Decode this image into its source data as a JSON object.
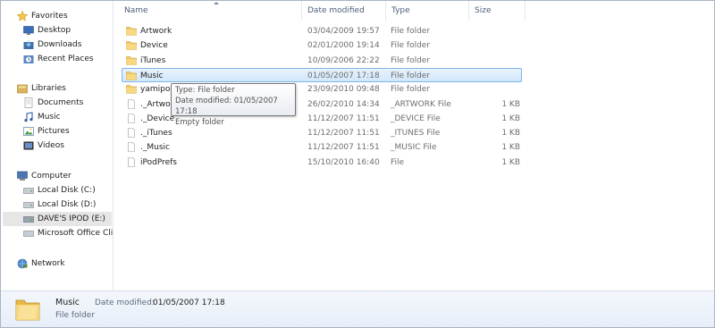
{
  "nav": {
    "favorites": {
      "label": "Favorites",
      "items": [
        "Desktop",
        "Downloads",
        "Recent Places"
      ]
    },
    "libraries": {
      "label": "Libraries",
      "items": [
        "Documents",
        "Music",
        "Pictures",
        "Videos"
      ]
    },
    "computer": {
      "label": "Computer",
      "items": [
        "Local Disk (C:)",
        "Local Disk (D:)",
        "DAVE'S IPOD (E:)",
        "Microsoft Office Clic"
      ]
    },
    "network": {
      "label": "Network"
    }
  },
  "columns": {
    "name": "Name",
    "date": "Date modified",
    "type": "Type",
    "size": "Size"
  },
  "files": [
    {
      "name": "Artwork",
      "date": "03/04/2009 19:57",
      "type": "File folder",
      "size": "",
      "icon": "folder"
    },
    {
      "name": "Device",
      "date": "02/01/2000 19:14",
      "type": "File folder",
      "size": "",
      "icon": "folder"
    },
    {
      "name": "iTunes",
      "date": "10/09/2006 22:22",
      "type": "File folder",
      "size": "",
      "icon": "folder"
    },
    {
      "name": "Music",
      "date": "01/05/2007 17:18",
      "type": "File folder",
      "size": "",
      "icon": "folder"
    },
    {
      "name": "yamipod",
      "date": "23/09/2010 09:48",
      "type": "File folder",
      "size": "",
      "icon": "folder"
    },
    {
      "name": "._Artwork",
      "date": "26/02/2010 14:34",
      "type": "_ARTWORK File",
      "size": "1 KB",
      "icon": "file"
    },
    {
      "name": "._Device",
      "date": "11/12/2007 11:51",
      "type": "_DEVICE File",
      "size": "1 KB",
      "icon": "file"
    },
    {
      "name": "._iTunes",
      "date": "11/12/2007 11:51",
      "type": "_ITUNES File",
      "size": "1 KB",
      "icon": "file"
    },
    {
      "name": "._Music",
      "date": "11/12/2007 11:51",
      "type": "_MUSIC File",
      "size": "1 KB",
      "icon": "file"
    },
    {
      "name": "iPodPrefs",
      "date": "15/10/2010 16:40",
      "type": "File",
      "size": "1 KB",
      "icon": "file"
    }
  ],
  "tooltip": {
    "line1": "Type: File folder",
    "line2": "Date modified: 01/05/2007 17:18",
    "line3": "Empty folder"
  },
  "details": {
    "name": "Music",
    "kind": "File folder",
    "date_label": "Date modified:",
    "date_value": "01/05/2007 17:18"
  },
  "colors": {
    "selection_border": "#7eb4ea",
    "folder": "#f2c862",
    "header_text": "#4c607a"
  }
}
